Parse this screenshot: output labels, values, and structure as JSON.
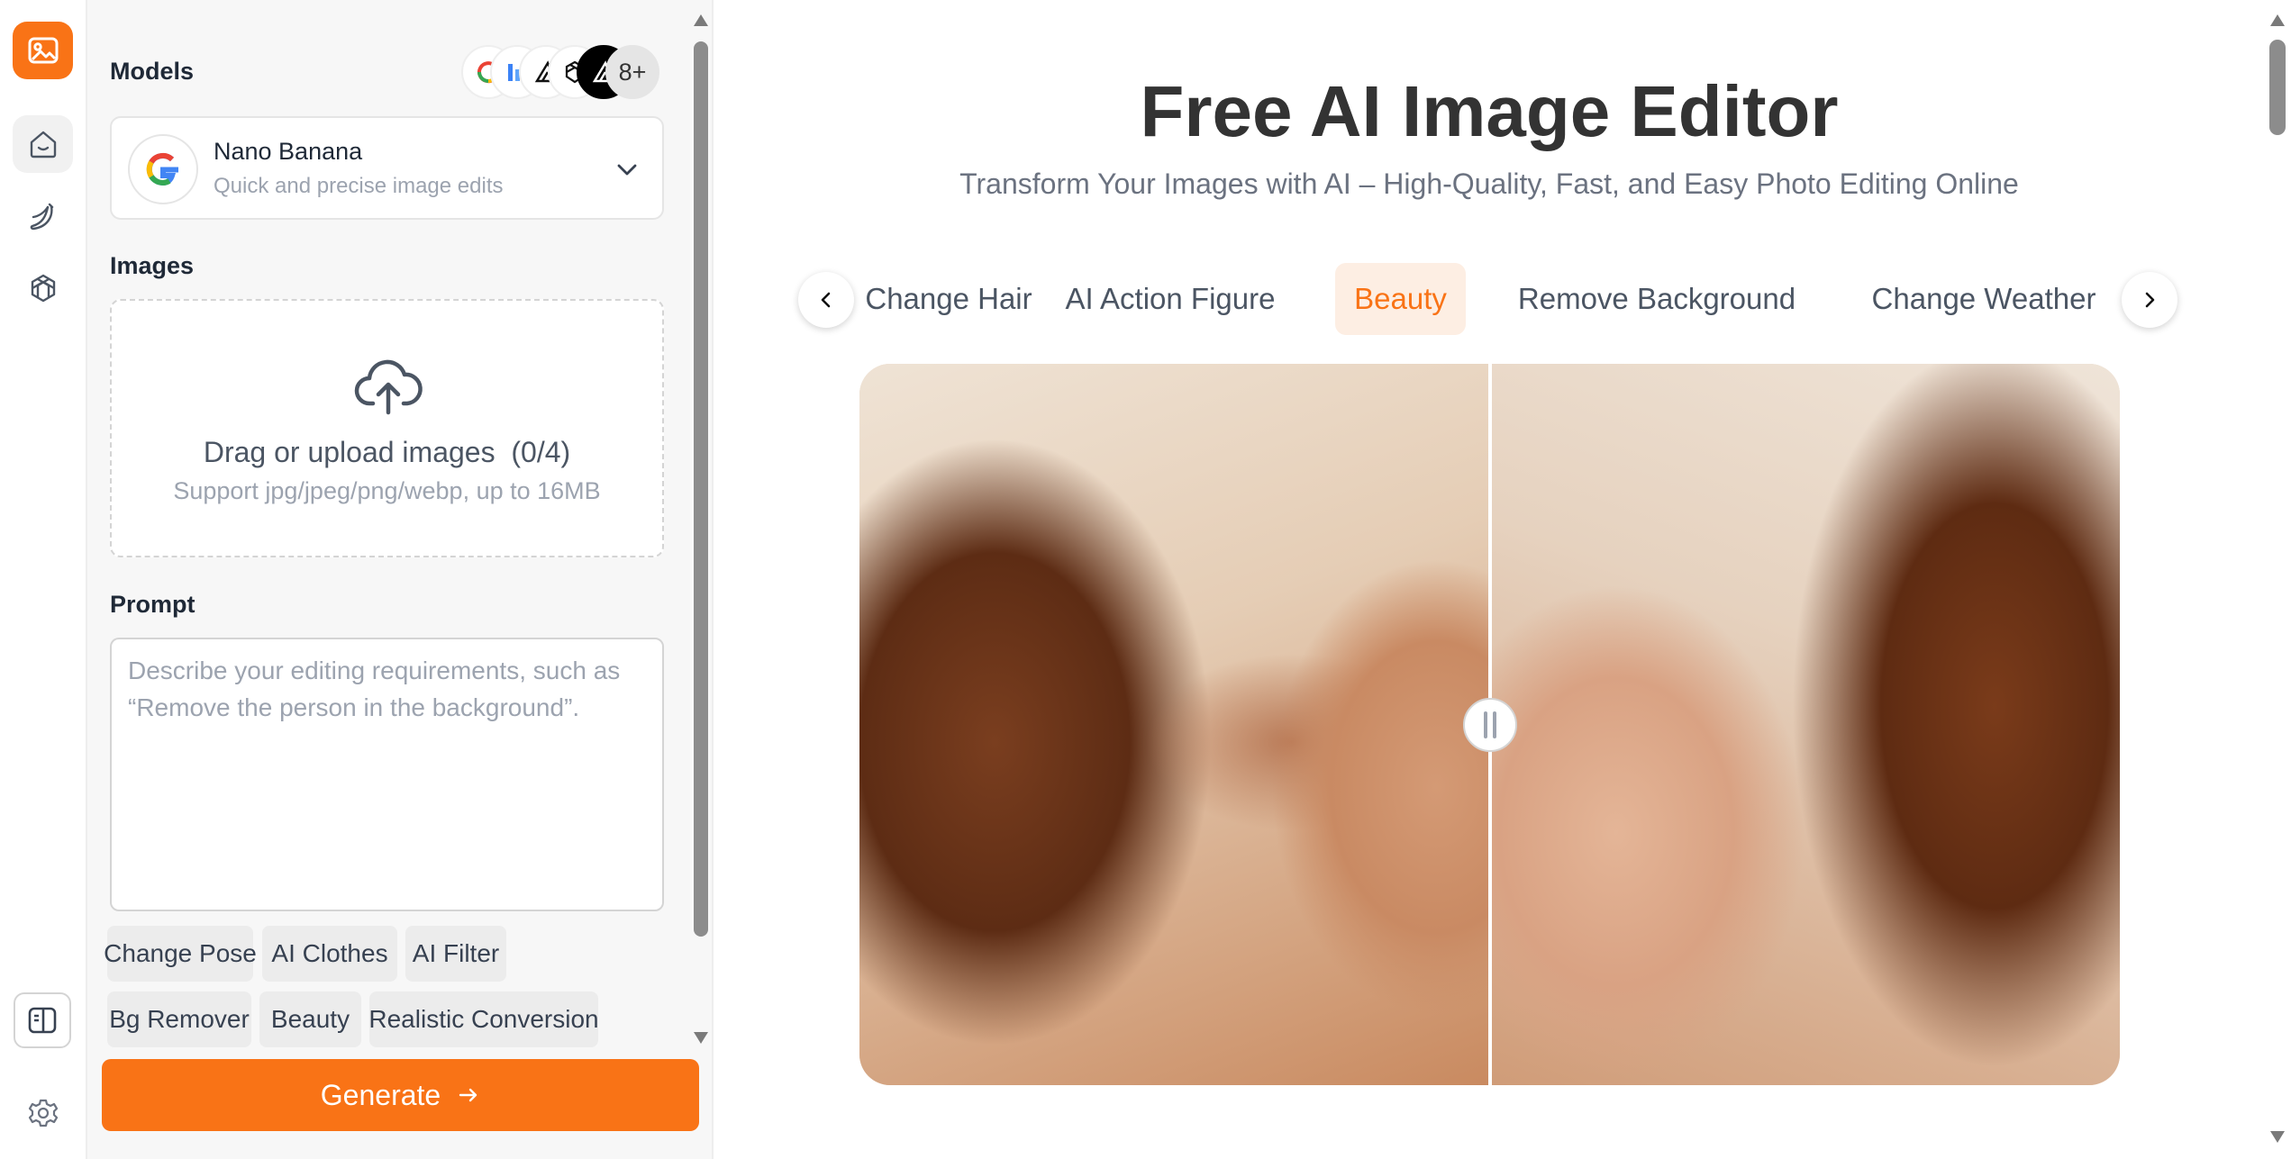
{
  "sidebar": {
    "models_label": "Models",
    "model_icons": [
      {
        "icon": "google-icon"
      },
      {
        "icon": "chart-bars-icon"
      },
      {
        "icon": "flux-icon"
      },
      {
        "icon": "openai-icon"
      },
      {
        "icon": "flux-dark-icon"
      }
    ],
    "model_more": "8+",
    "selected_model": {
      "name": "Nano Banana",
      "description": "Quick and precise image edits",
      "icon": "google-icon"
    },
    "images_label": "Images",
    "upload": {
      "title": "Drag or upload images  (0/4)",
      "subtitle": "Support jpg/jpeg/png/webp, up to 16MB",
      "icon": "cloud-upload-icon"
    },
    "prompt_label": "Prompt",
    "prompt": {
      "value": "",
      "placeholder": "Describe your editing requirements, such as “Remove the person in the background”."
    },
    "chips": [
      "Change Pose",
      "AI Clothes",
      "AI Filter",
      "Bg Remover",
      "Beauty",
      "Realistic Conversion"
    ],
    "generate_label": "Generate",
    "generate_icon": "arrow-right-icon"
  },
  "rail": {
    "items": [
      "app-logo-icon",
      "home-icon",
      "banana-icon",
      "openai-icon"
    ],
    "bottom": [
      "panel-toggle-icon",
      "gear-icon"
    ]
  },
  "main": {
    "title": "Free AI Image Editor",
    "subtitle": "Transform Your Images with AI – High-Quality, Fast, and Easy Photo Editing Online",
    "tabs": [
      {
        "label": "Change Hair",
        "active": false
      },
      {
        "label": "AI Action Figure",
        "active": false
      },
      {
        "label": "Beauty",
        "active": true
      },
      {
        "label": "Remove Background",
        "active": false
      },
      {
        "label": "Change Weather",
        "active": false
      }
    ],
    "compare": {
      "before": "before-image",
      "after": "after-image",
      "split_position": 0.5
    }
  },
  "colors": {
    "accent": "#f97316",
    "accent_soft": "#fdeee3",
    "title": "#333333",
    "subtitle": "#6b7280"
  }
}
